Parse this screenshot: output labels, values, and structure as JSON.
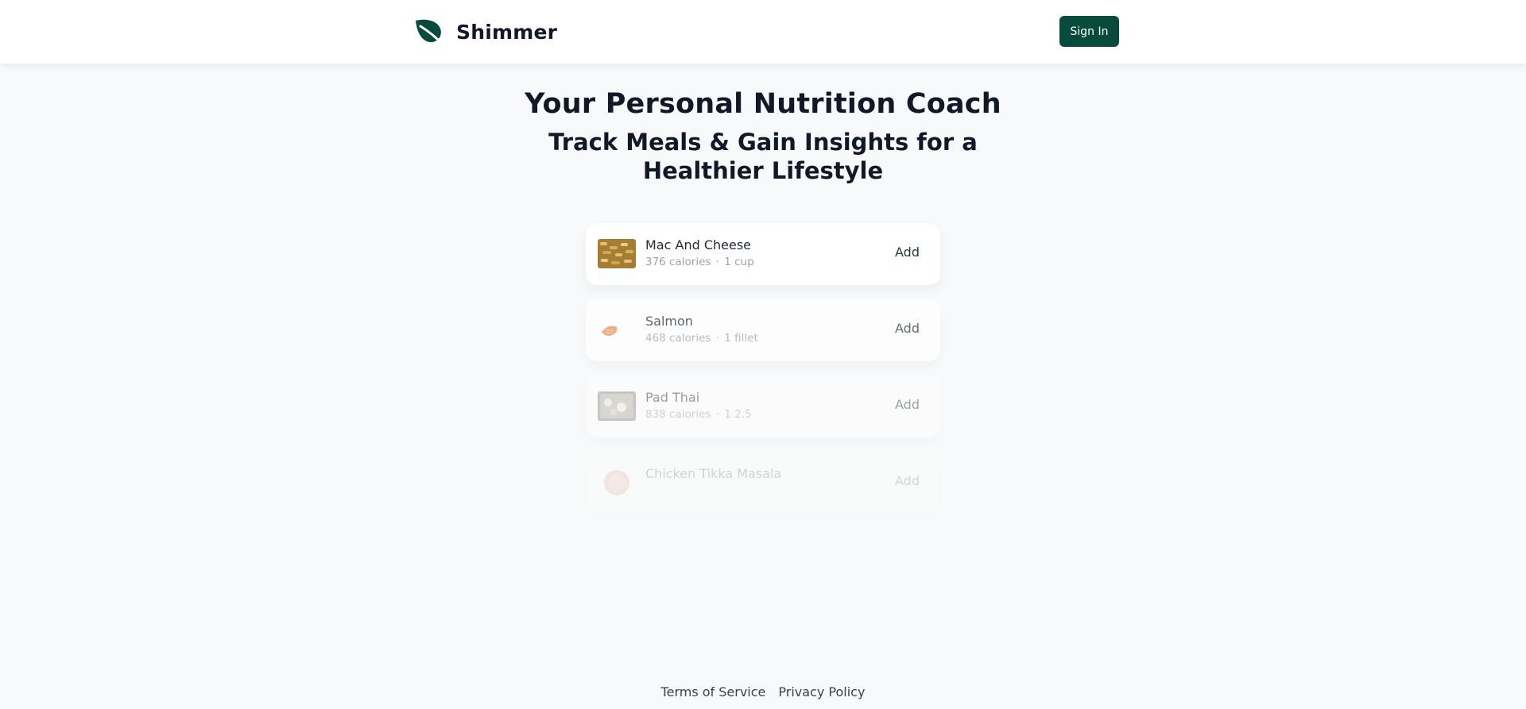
{
  "brand": {
    "name": "Shimmer",
    "icon": "leaf-icon",
    "color": "#074b3d"
  },
  "header": {
    "signin_label": "Sign In"
  },
  "hero": {
    "title": "Your Personal Nutrition Coach",
    "subtitle": "Track Meals & Gain Insights for a Healthier Lifestyle"
  },
  "foods": [
    {
      "name": "Mac And Cheese",
      "calories": "376 calories",
      "serving": "1 cup",
      "add_label": "Add"
    },
    {
      "name": "Salmon",
      "calories": "468 calories",
      "serving": "1 fillet",
      "add_label": "Add"
    },
    {
      "name": "Pad Thai",
      "calories": "838 calories",
      "serving": "1 2.5",
      "add_label": "Add"
    },
    {
      "name": "Chicken Tikka Masala",
      "calories": "",
      "serving": "",
      "add_label": "Add"
    }
  ],
  "footer": {
    "terms": "Terms of Service",
    "privacy": "Privacy Policy"
  }
}
